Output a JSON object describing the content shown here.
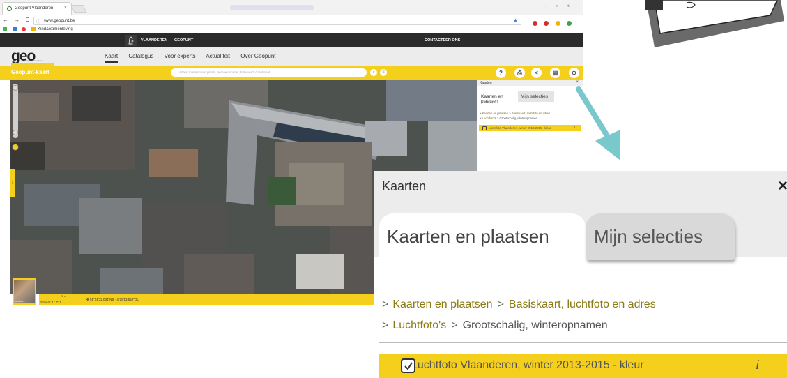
{
  "browser": {
    "tab_title": "Geopunt Vlaanderen",
    "tab_close": "×",
    "window_controls": "– ▫ ×",
    "nav_glyphs": "← → C",
    "url_info_icon": "ⓘ",
    "url": "www.geopunt.be",
    "bookmark_label": "Kind&Samenleving",
    "star_icon": "★",
    "extension_colors": [
      "#d32f2f",
      "#d32f2f",
      "#f4b400",
      "#43a047",
      "#d32f2f"
    ]
  },
  "site": {
    "top_items": [
      "VLAANDEREN",
      "GEOPUNT"
    ],
    "contact_label": "CONTACTEER ONS",
    "logo": "geo",
    "logo_sub": "Geopunt Vlaanderen",
    "nav": [
      "Kaart",
      "Catalogus",
      "Voor experts",
      "Actualiteit",
      "Over Geopunt"
    ],
    "app_title": "Geopunt-kaart",
    "search_placeholder": "Adres, interessante plaats, perceelnummer, trefwoord, coördinaat",
    "toolbar_icons": [
      "?",
      "⎙",
      "<",
      "▤",
      "⊕"
    ],
    "accent_color": "#f4cf1c"
  },
  "map": {
    "side_tab_glyph": "›",
    "thumb_label": "Luchtfoto",
    "scale_value": "20 m",
    "scale_text": "Schaal: 1 : 711",
    "coordinate_icon": "✥",
    "coordinates": "51°01'32,034\"NB · 4°29'13,552\"OL"
  },
  "panel": {
    "title": "Kaarten",
    "close_label": "×",
    "tab_active": "Kaarten en plaatsen",
    "tab_inactive": "Mijn selecties",
    "chevron": ">",
    "crumb1_a": "Kaarten en plaatsen",
    "crumb1_b": "Basiskaart, luchtfoto en adres",
    "crumb2_a": "Luchtfoto's",
    "crumb2_b": "Grootschalig, winteropnamen",
    "selected_layer": "Luchtfoto Vlaanderen, winter 2013-2015 - kleur",
    "info_label": "i"
  },
  "small_panel": {
    "crumb1_b": "Basiskaart, luchtfoto en adres",
    "crumb2_b": "Grootschalig, winteropnamen",
    "selected_layer": "Luchtfoto Vlaanderen, winter 2013-2015 - kleur"
  },
  "colors": {
    "arrow": "#79c8cc",
    "link_gold": "#8a7a12"
  }
}
